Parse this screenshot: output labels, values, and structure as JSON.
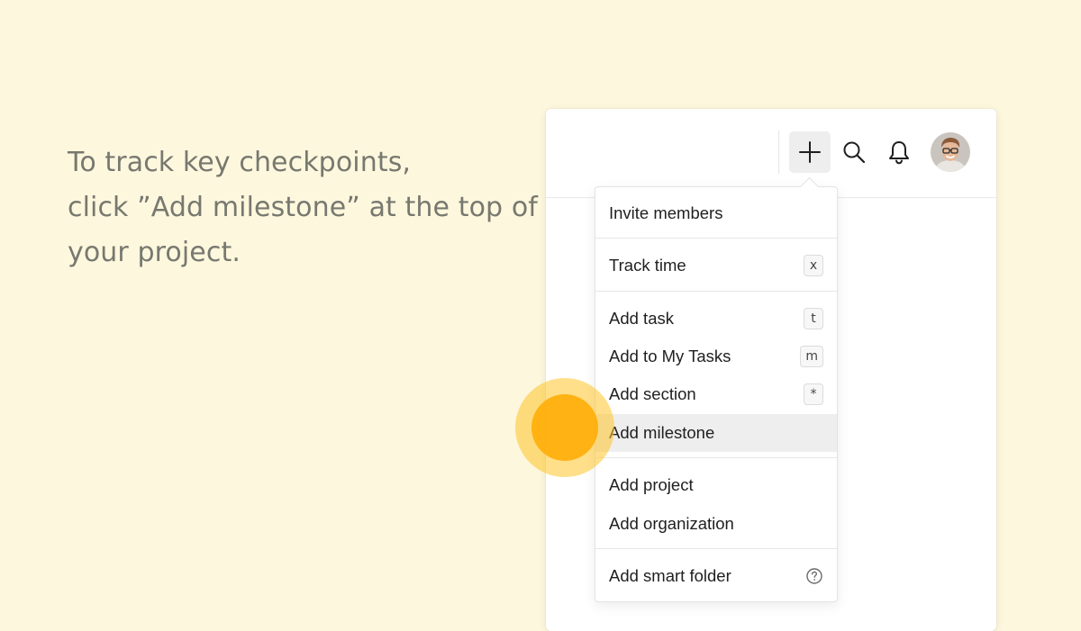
{
  "instruction": {
    "line1": "To track key checkpoints,",
    "line2": "click ”Add milestone” at the top of",
    "line3": "your project."
  },
  "topbar": {
    "add_icon": "plus-icon",
    "search_icon": "search-icon",
    "bell_icon": "bell-icon",
    "avatar": "user-avatar"
  },
  "menu": {
    "invite_members": "Invite members",
    "track_time": {
      "label": "Track time",
      "shortcut": "x"
    },
    "add_task": {
      "label": "Add task",
      "shortcut": "t"
    },
    "add_to_my_tasks": {
      "label": "Add to My Tasks",
      "shortcut": "m"
    },
    "add_section": {
      "label": "Add section",
      "shortcut": "*"
    },
    "add_milestone": {
      "label": "Add milestone",
      "highlighted": true
    },
    "add_project": "Add project",
    "add_organization": "Add organization",
    "add_smart_folder": {
      "label": "Add smart folder",
      "icon": "help-circle-icon"
    }
  },
  "colors": {
    "background": "#fdf7dd",
    "instruction_text": "#77786f",
    "highlight": "#eeeeee",
    "click_indicator": "#ffb000"
  }
}
